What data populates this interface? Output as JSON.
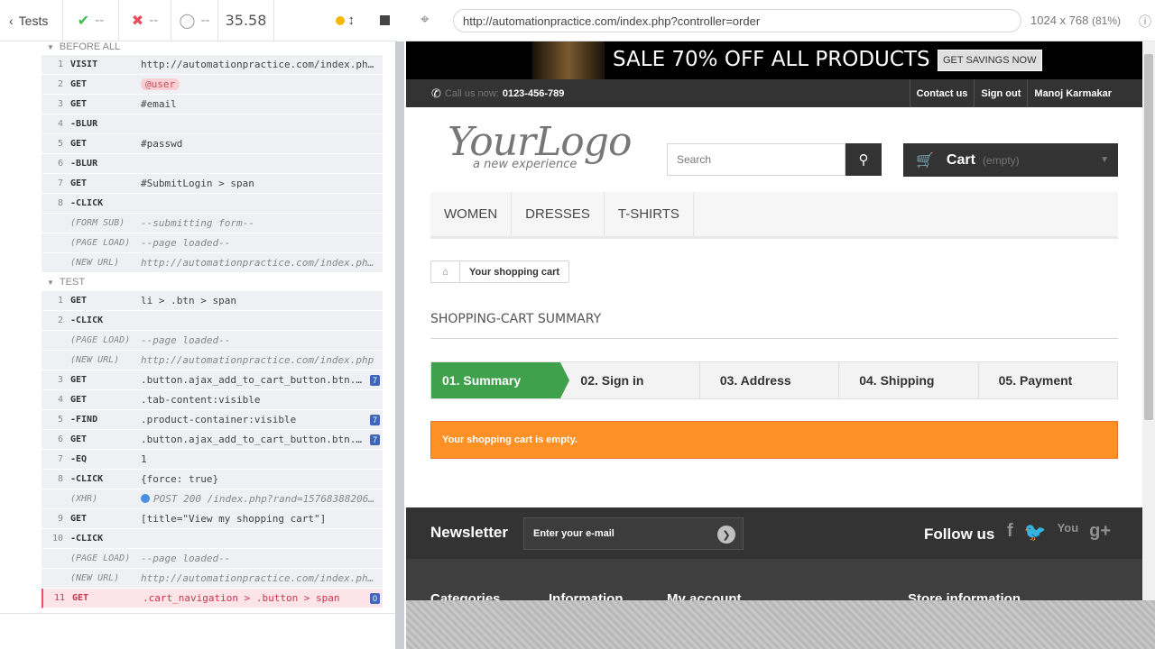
{
  "runner": {
    "tests_label": "Tests",
    "passed": "--",
    "failed": "--",
    "pending": "--",
    "duration": "35.58",
    "status_dot_color": "#f5b700"
  },
  "hooks": {
    "before_all": "BEFORE ALL",
    "test": "TEST"
  },
  "before_all_commands": [
    {
      "num": "1",
      "name": "VISIT",
      "msg": "http://automationpractice.com/index.ph..."
    },
    {
      "num": "2",
      "name": "GET",
      "msg": "@user"
    },
    {
      "num": "3",
      "name": "GET",
      "msg": "#email"
    },
    {
      "num": "4",
      "name": "-BLUR",
      "msg": ""
    },
    {
      "num": "5",
      "name": "GET",
      "msg": "#passwd"
    },
    {
      "num": "6",
      "name": "-BLUR",
      "msg": ""
    },
    {
      "num": "7",
      "name": "GET",
      "msg": "#SubmitLogin > span"
    },
    {
      "num": "8",
      "name": "-CLICK",
      "msg": ""
    },
    {
      "num": "",
      "name": "(FORM SUB)",
      "msg": "--submitting form--"
    },
    {
      "num": "",
      "name": "(PAGE LOAD)",
      "msg": "--page loaded--"
    },
    {
      "num": "",
      "name": "(NEW URL)",
      "msg": "http://automationpractice.com/index.ph..."
    }
  ],
  "test_commands": [
    {
      "num": "1",
      "name": "GET",
      "msg": "li > .btn > span",
      "badge": ""
    },
    {
      "num": "2",
      "name": "-CLICK",
      "msg": "",
      "badge": ""
    },
    {
      "num": "",
      "name": "(PAGE LOAD)",
      "msg": "--page loaded--",
      "badge": ""
    },
    {
      "num": "",
      "name": "(NEW URL)",
      "msg": "http://automationpractice.com/index.php",
      "badge": ""
    },
    {
      "num": "3",
      "name": "GET",
      "msg": ".button.ajax_add_to_cart_button.btn...",
      "badge": "7"
    },
    {
      "num": "4",
      "name": "GET",
      "msg": ".tab-content:visible",
      "badge": ""
    },
    {
      "num": "5",
      "name": "-FIND",
      "msg": ".product-container:visible",
      "badge": "7"
    },
    {
      "num": "6",
      "name": "GET",
      "msg": ".button.ajax_add_to_cart_button.btn...",
      "badge": "7"
    },
    {
      "num": "7",
      "name": "-EQ",
      "msg": "1",
      "badge": ""
    },
    {
      "num": "8",
      "name": "-CLICK",
      "msg": "{force: true}",
      "badge": ""
    },
    {
      "num": "",
      "name": "(XHR)",
      "msg": "POST 200 /index.php?rand=15768388206...",
      "badge": ""
    },
    {
      "num": "9",
      "name": "GET",
      "msg": "[title=\"View my shopping cart\"]",
      "badge": ""
    },
    {
      "num": "10",
      "name": "-CLICK",
      "msg": "",
      "badge": ""
    },
    {
      "num": "",
      "name": "(PAGE LOAD)",
      "msg": "--page loaded--",
      "badge": ""
    },
    {
      "num": "",
      "name": "(NEW URL)",
      "msg": "http://automationpractice.com/index.ph...",
      "badge": ""
    },
    {
      "num": "11",
      "name": "GET",
      "msg": ".cart_navigation > .button > span",
      "badge": "0"
    }
  ],
  "browser": {
    "url": "http://automationpractice.com/index.php?controller=order",
    "viewport": "1024 x 768",
    "scale": "(81%)"
  },
  "site": {
    "banner_text": "SALE 70% OFF ALL PRODUCTS",
    "banner_button": "GET SAVINGS NOW",
    "call_label": "Call us now:",
    "phone": "0123-456-789",
    "links": [
      "Contact us",
      "Sign out",
      "Manoj Karmakar"
    ],
    "logo": "YourLogo",
    "logo_sub": "a new experience",
    "search_placeholder": "Search",
    "cart_label": "Cart",
    "cart_state": "(empty)",
    "menu": [
      "WOMEN",
      "DRESSES",
      "T-SHIRTS"
    ],
    "breadcrumb": "Your shopping cart",
    "heading": "SHOPPING-CART SUMMARY",
    "steps": [
      "01. Summary",
      "02. Sign in",
      "03. Address",
      "04. Shipping",
      "05. Payment"
    ],
    "alert": "Your shopping cart is empty.",
    "newsletter": "Newsletter",
    "newsletter_placeholder": "Enter your e-mail",
    "follow": "Follow us",
    "footer_cols": [
      "Categories",
      "Information",
      "My account",
      "Store information"
    ],
    "accent": "#3fa14b",
    "alert_color": "#fe9126"
  }
}
